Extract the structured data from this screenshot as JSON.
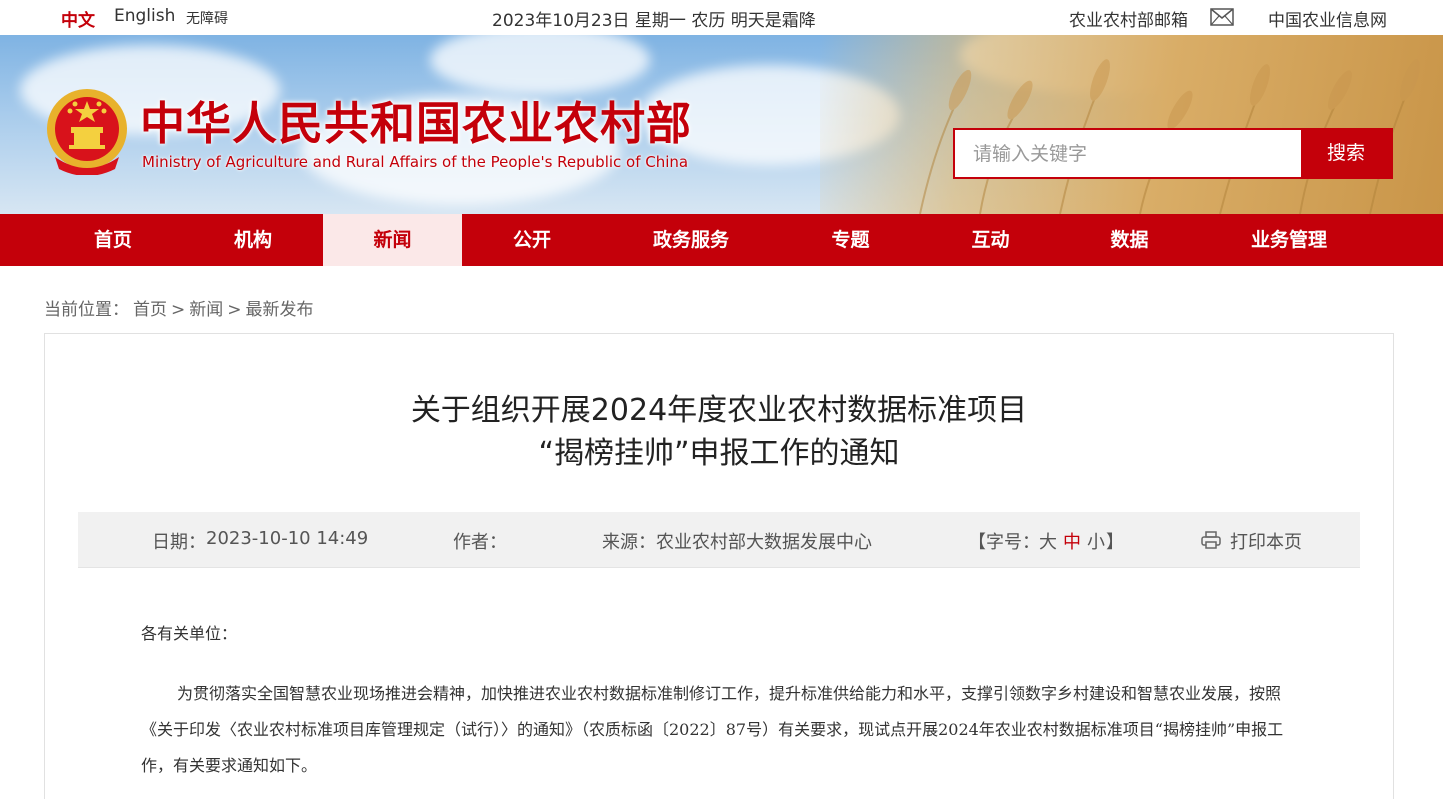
{
  "topbar": {
    "lang_zh": "中文",
    "lang_en": "English",
    "accessibility": "无障碍",
    "date": "2023年10月23日 星期一 农历 明天是霜降",
    "mailbox": "农业农村部邮箱",
    "info_network": "中国农业信息网"
  },
  "header": {
    "title": "中华人民共和国农业农村部",
    "subtitle": "Ministry of Agriculture and Rural Affairs of the People's Republic of China",
    "search_placeholder": "请输入关键字",
    "search_button": "搜索"
  },
  "nav": {
    "items": [
      {
        "label": "首页"
      },
      {
        "label": "机构"
      },
      {
        "label": "新闻"
      },
      {
        "label": "公开"
      },
      {
        "label": "政务服务"
      },
      {
        "label": "专题"
      },
      {
        "label": "互动"
      },
      {
        "label": "数据"
      },
      {
        "label": "业务管理"
      }
    ],
    "active_index": 2
  },
  "breadcrumb": {
    "prefix": "当前位置：",
    "items": [
      "首页",
      "新闻",
      "最新发布"
    ],
    "separator": ">"
  },
  "article": {
    "title_line1": "关于组织开展2024年度农业农村数据标准项目",
    "title_line2": "“揭榜挂帅”申报工作的通知",
    "meta": {
      "date_label": "日期：",
      "date_value": "2023-10-10 14:49",
      "author_label": "作者：",
      "source_label": "来源：",
      "source_value": "农业农村部大数据发展中心",
      "fontsize_open": "【字号：",
      "fontsize_large": "大",
      "fontsize_medium": "中",
      "fontsize_small": "小",
      "fontsize_close": "】",
      "print": "打印本页"
    },
    "salutation": "各有关单位：",
    "paragraph1": "为贯彻落实全国智慧农业现场推进会精神，加快推进农业农村数据标准制修订工作，提升标准供给能力和水平，支撑引领数字乡村建设和智慧农业发展，按照《关于印发〈农业农村标准项目库管理规定（试行）〉的通知》（农质标函〔2022〕87号）有关要求，现试点开展2024年农业农村数据标准项目“揭榜挂帅”申报工作，有关要求通知如下。"
  },
  "colors": {
    "brand_red": "#c4000a",
    "nav_active_bg": "#fbe8e8",
    "meta_bg": "#f1f1f1"
  }
}
